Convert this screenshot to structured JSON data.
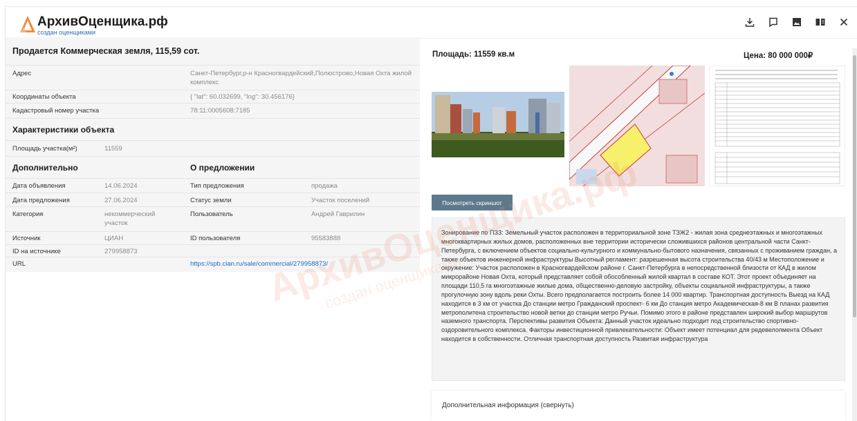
{
  "brand": {
    "title": "АрхивОценщика.рф",
    "subtitle": "создан оценщиками"
  },
  "header_icons": [
    "download-icon",
    "chat-icon",
    "image-icon",
    "book-icon",
    "close-icon"
  ],
  "listing": {
    "title": "Продается Коммерческая земля, 115,59 сот.",
    "address_label": "Адрес",
    "address_value": "Санкт-Петербург,р-н Красногвардейский,Полюстрово,Новая Охта жилой комплекс",
    "coords_label": "Координаты объекта",
    "coords_value": "{ \"lat\": 60.032699, \"lng\": 30.456176}",
    "cadastral_label": "Кадастровый номер участка",
    "cadastral_value": "78:11:0005608:7185",
    "characteristics_heading": "Характеристики объекта",
    "area_label": "Площадь участка(м²)",
    "area_value": "11559",
    "additional_heading": "Дополнительно",
    "offer_heading": "О предложении",
    "announce_date_label": "Дата объявления",
    "announce_date_value": "14.06.2024",
    "offer_date_label": "Дата предложения",
    "offer_date_value": "27.06.2024",
    "category_label": "Категория",
    "category_value": "некоммерческий участок",
    "source_label": "Источник",
    "source_value": "ЦИАН",
    "source_id_label": "ID на источнике",
    "source_id_value": "279958873",
    "url_label": "URL",
    "offer_type_label": "Тип предложения",
    "offer_type_value": "продажа",
    "land_status_label": "Статус земли",
    "land_status_value": "Участок поселений",
    "user_label": "Пользователь",
    "user_value": "Андрей Гаврилин",
    "user_id_label": "ID пользователя",
    "user_id_value": "95583888",
    "url_value": "https://spb.cian.ru/sale/commercial/279958873/"
  },
  "summary": {
    "area": "Площадь: 11559 кв.м",
    "price": "Цена: 80 000 000₽"
  },
  "screenshot_button": "Посмотреть скриншот",
  "description": "Зонирование по ПЗЗ: Земельный участок расположен в территориальной зоне ТЗЖ2 - жилая зона среднеэтажных и многоэтажных многоквартирных жилых домов, расположенных вне территории исторически сложившихся районов центральной части Санкт-Петербурга, с включением объектов социально-культурного и коммунально-бытового назначения, связанных с проживанием граждан, а также объектов инженерной инфраструктуры Высотный регламент: разрешенная высота строительства 40/43 м Местоположение и окружение: Участок расположен в Красногвардейском районе г. Санкт-Петербурга в непосредственной близости от КАД в жилом микрорайоне Новая Охта, который представляет собой обособленный жилой квартал в составе КОТ. Этот проект объединяет на площади 110,5 га многоэтажные жилые дома, общественно-деловую застройку, объекты социальной инфраструктуры, а также прогулочную зону вдоль реки Охты. Всего предполагается построить более 14 000 квартир. Транспортная доступность Выезд на КАД находится в 3 км от участка До станции метро Гражданский проспект- 6 км До станция метро Академическая-8 км В планах развития метрополитена строительство новой ветки до станции метро Ручьи. Помимо этого в районе представлен широкий выбор маршрутов наземного транспорта. Перспективы развития Объекта: Данный участок идеально подходит под строительство спортивно-оздоровительного комплекса. Факторы инвестиционной привлекательности: Объект имеет потенциал для редевелопмента Объект находится в собственности. Отличная транспортная доступность Развитая инфраструктура",
  "extra_info": "Дополнительная информация (свернуть)",
  "colors": {
    "accent_orange": "#f08a3c",
    "link_blue": "#1f6bc4",
    "button_slate": "#5d7a8c"
  }
}
